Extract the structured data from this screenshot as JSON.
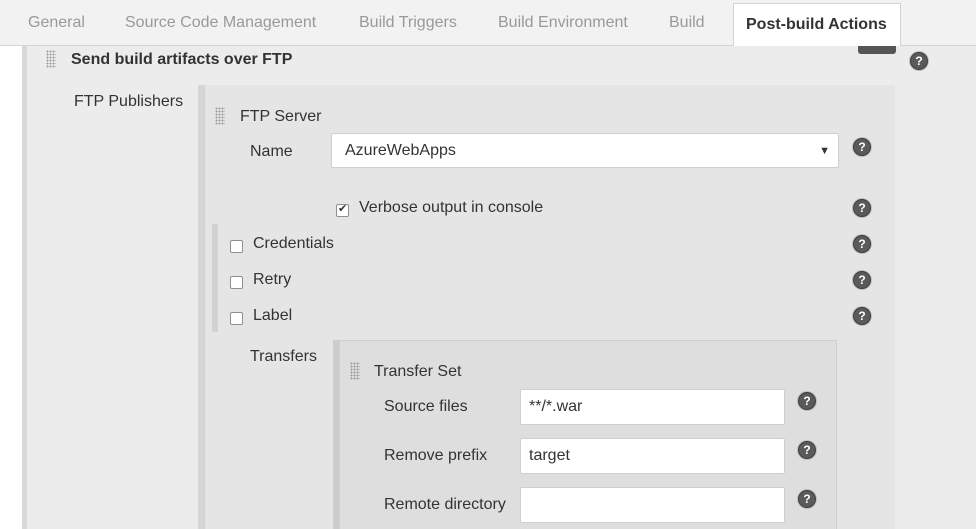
{
  "tabs": [
    {
      "label": "General"
    },
    {
      "label": "Source Code Management"
    },
    {
      "label": "Build Triggers"
    },
    {
      "label": "Build Environment"
    },
    {
      "label": "Build"
    },
    {
      "label": "Post-build Actions",
      "active": true
    }
  ],
  "section": {
    "title": "Send build artifacts over FTP"
  },
  "ftp_publishers": {
    "label": "FTP Publishers"
  },
  "ftp_server": {
    "title": "FTP Server",
    "name_label": "Name",
    "name_value": "AzureWebApps",
    "verbose": {
      "label": "Verbose output in console",
      "checked": true
    },
    "credentials": {
      "label": "Credentials",
      "checked": false
    },
    "retry": {
      "label": "Retry",
      "checked": false
    },
    "label_opt": {
      "label": "Label",
      "checked": false
    }
  },
  "transfers": {
    "label": "Transfers",
    "set_title": "Transfer Set",
    "source_files": {
      "label": "Source files",
      "value": "**/*.war"
    },
    "remove_prefix": {
      "label": "Remove prefix",
      "value": "target"
    },
    "remote_directory": {
      "label": "Remote directory",
      "value": ""
    }
  },
  "icons": {
    "help": "help-icon",
    "handle": "drag-handle-icon",
    "caret": "caret-down-icon"
  },
  "colors": {
    "tab_bar": "#f2f2f2",
    "section_bg": "#ececec",
    "panel_bg": "#e5e5e5",
    "help_icon": "#5a5a5a"
  }
}
